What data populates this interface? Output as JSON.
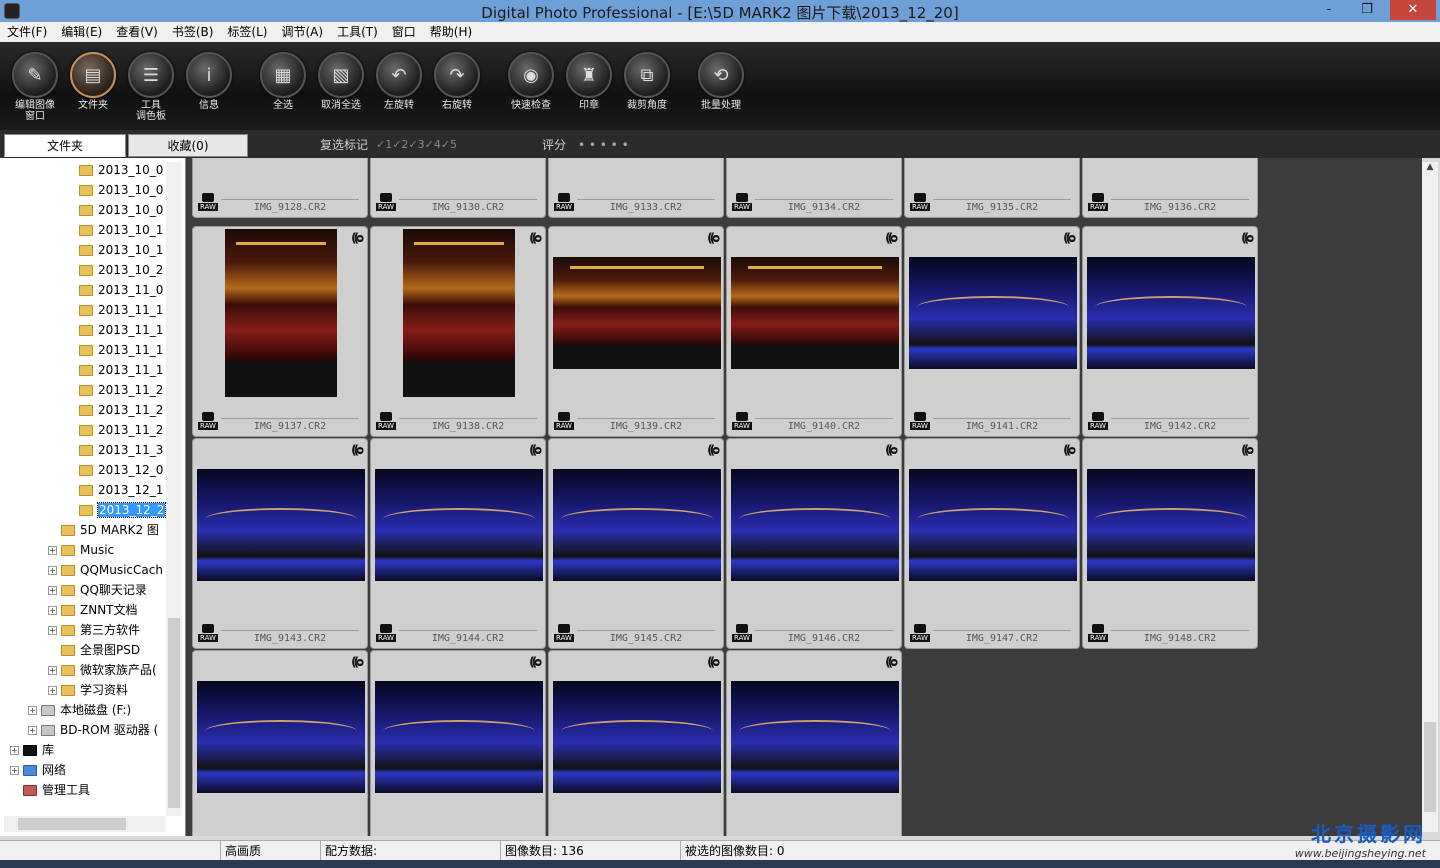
{
  "window": {
    "title": "Digital Photo Professional - [E:\\5D MARK2 图片下载\\2013_12_20]",
    "minimize": "-",
    "restore": "❐",
    "close": "✕"
  },
  "menu": [
    "文件(F)",
    "编辑(E)",
    "查看(V)",
    "书签(B)",
    "标签(L)",
    "调节(A)",
    "工具(T)",
    "窗口",
    "帮助(H)"
  ],
  "toolbar": [
    {
      "label": "编辑图像\n窗口",
      "icon": "edit-window-icon",
      "glyph": "✎"
    },
    {
      "label": "文件夹",
      "icon": "folder-icon",
      "glyph": "▤",
      "active": true
    },
    {
      "label": "工具\n调色板",
      "icon": "tool-palette-icon",
      "glyph": "☰"
    },
    {
      "label": "信息",
      "icon": "info-icon",
      "glyph": "i"
    },
    {
      "label": "全选",
      "icon": "select-all-icon",
      "glyph": "▦"
    },
    {
      "label": "取消全选",
      "icon": "deselect-all-icon",
      "glyph": "▧"
    },
    {
      "label": "左旋转",
      "icon": "rotate-left-icon",
      "glyph": "↶"
    },
    {
      "label": "右旋转",
      "icon": "rotate-right-icon",
      "glyph": "↷"
    },
    {
      "label": "快速检查",
      "icon": "quick-check-icon",
      "glyph": "◉"
    },
    {
      "label": "印章",
      "icon": "stamp-icon",
      "glyph": "♜"
    },
    {
      "label": "裁剪角度",
      "icon": "crop-angle-icon",
      "glyph": "⧉"
    },
    {
      "label": "批量处理",
      "icon": "batch-process-icon",
      "glyph": "⟲"
    }
  ],
  "tabs": {
    "folder": "文件夹",
    "favorites": "收藏(0)"
  },
  "filter": {
    "check_label": "复选标记",
    "checks": "✓1✓2✓3✓4✓5",
    "rating_label": "评分",
    "rating_dots": "• • • • •"
  },
  "tree": [
    {
      "label": "2013_10_0",
      "level": 4
    },
    {
      "label": "2013_10_0",
      "level": 4
    },
    {
      "label": "2013_10_0",
      "level": 4
    },
    {
      "label": "2013_10_1",
      "level": 4
    },
    {
      "label": "2013_10_1",
      "level": 4
    },
    {
      "label": "2013_10_2",
      "level": 4
    },
    {
      "label": "2013_11_0",
      "level": 4
    },
    {
      "label": "2013_11_1",
      "level": 4
    },
    {
      "label": "2013_11_1",
      "level": 4
    },
    {
      "label": "2013_11_1",
      "level": 4
    },
    {
      "label": "2013_11_1",
      "level": 4
    },
    {
      "label": "2013_11_2",
      "level": 4
    },
    {
      "label": "2013_11_2",
      "level": 4
    },
    {
      "label": "2013_11_2",
      "level": 4
    },
    {
      "label": "2013_11_3",
      "level": 4
    },
    {
      "label": "2013_12_0",
      "level": 4
    },
    {
      "label": "2013_12_1",
      "level": 4
    },
    {
      "label": "2013_12_2",
      "level": 4,
      "selected": true
    },
    {
      "label": "5D MARK2 图",
      "level": 3
    },
    {
      "label": "Music",
      "level": 3,
      "expand": true
    },
    {
      "label": "QQMusicCach",
      "level": 3,
      "expand": true
    },
    {
      "label": "QQ聊天记录",
      "level": 3,
      "expand": true
    },
    {
      "label": "ZNNT文档",
      "level": 3,
      "expand": true
    },
    {
      "label": "第三方软件",
      "level": 3,
      "expand": true
    },
    {
      "label": "全景图PSD",
      "level": 3
    },
    {
      "label": "微软家族产品(",
      "level": 3,
      "expand": true
    },
    {
      "label": "学习资料",
      "level": 3,
      "expand": true
    },
    {
      "label": "本地磁盘 (F:)",
      "level": 2,
      "expand": true,
      "kind": "drive"
    },
    {
      "label": "BD-ROM 驱动器 (",
      "level": 2,
      "expand": true,
      "kind": "drive"
    },
    {
      "label": "库",
      "level": 1,
      "expand": true,
      "kind": "library"
    },
    {
      "label": "网络",
      "level": 1,
      "expand": true,
      "kind": "network"
    },
    {
      "label": "管理工具",
      "level": 1,
      "kind": "tools"
    }
  ],
  "thumbnails": [
    {
      "name": "IMG_9128.CR2",
      "style": "none"
    },
    {
      "name": "IMG_9130.CR2",
      "style": "none"
    },
    {
      "name": "IMG_9133.CR2",
      "style": "none"
    },
    {
      "name": "IMG_9134.CR2",
      "style": "none"
    },
    {
      "name": "IMG_9135.CR2",
      "style": "none"
    },
    {
      "name": "IMG_9136.CR2",
      "style": "none"
    },
    {
      "name": "IMG_9137.CR2",
      "style": "red-portrait"
    },
    {
      "name": "IMG_9138.CR2",
      "style": "red-portrait"
    },
    {
      "name": "IMG_9139.CR2",
      "style": "red"
    },
    {
      "name": "IMG_9140.CR2",
      "style": "red"
    },
    {
      "name": "IMG_9141.CR2",
      "style": "blue"
    },
    {
      "name": "IMG_9142.CR2",
      "style": "blue"
    },
    {
      "name": "IMG_9143.CR2",
      "style": "blue"
    },
    {
      "name": "IMG_9144.CR2",
      "style": "blue"
    },
    {
      "name": "IMG_9145.CR2",
      "style": "blue"
    },
    {
      "name": "IMG_9146.CR2",
      "style": "blue"
    },
    {
      "name": "IMG_9147.CR2",
      "style": "blue"
    },
    {
      "name": "IMG_9148.CR2",
      "style": "blue"
    },
    {
      "name": "",
      "style": "blue"
    },
    {
      "name": "",
      "style": "blue"
    },
    {
      "name": "",
      "style": "blue"
    },
    {
      "name": "",
      "style": "blue"
    }
  ],
  "status": {
    "quality": "高画质",
    "recipe_label": "配方数据:",
    "image_count": "图像数目: 136",
    "selected_count": "被选的图像数目: 0"
  },
  "watermark": {
    "brand": "北京摄影网",
    "url": "www.beijingsheying.net"
  }
}
